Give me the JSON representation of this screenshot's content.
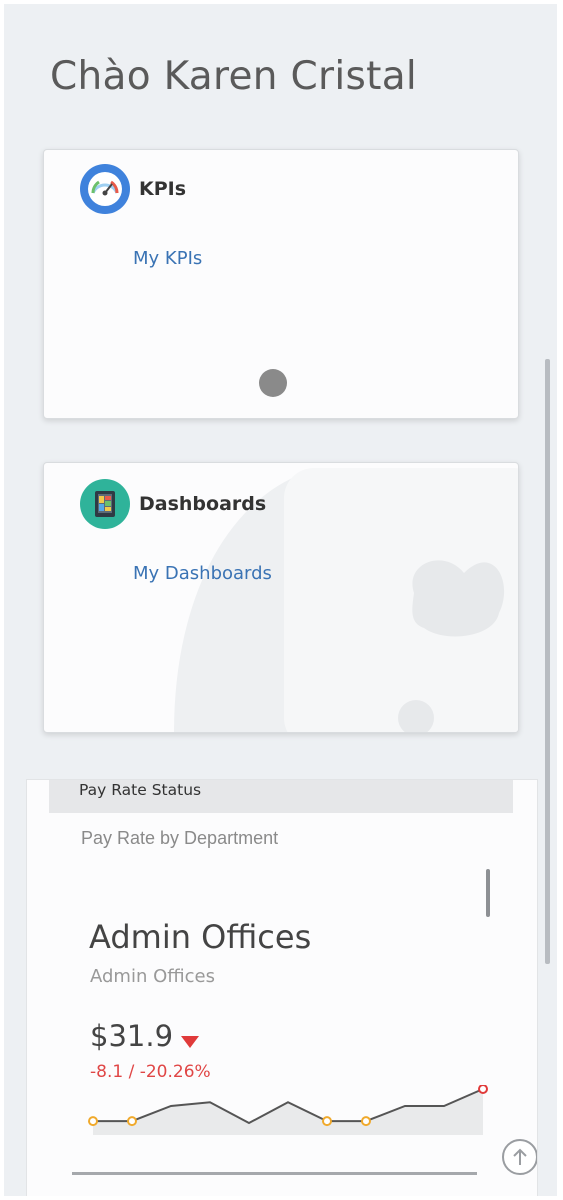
{
  "greeting": "Chào Karen Cristal",
  "kpi_card": {
    "title": "KPIs",
    "link": "My KPIs",
    "icon": "gauge-icon",
    "icon_color": "#3f82dc"
  },
  "dashboard_card": {
    "title": "Dashboards",
    "link": "My Dashboards",
    "icon": "dashboard-tablet-icon",
    "icon_color": "#2fb39a"
  },
  "pay_rate": {
    "header": "Pay Rate Status",
    "subtitle": "Pay Rate by Department",
    "department": "Admin Offices",
    "department_sub": "Admin Offices",
    "value": "$31.9",
    "trend": "down",
    "change": "-8.1 / -20.26%",
    "sparkline": [
      20,
      20,
      12,
      10,
      21,
      10,
      20,
      20,
      12,
      12,
      3
    ],
    "colors": {
      "positive_change": "#e04646",
      "marker_normal": "#f0a92b",
      "marker_last": "#e03a3a"
    }
  }
}
